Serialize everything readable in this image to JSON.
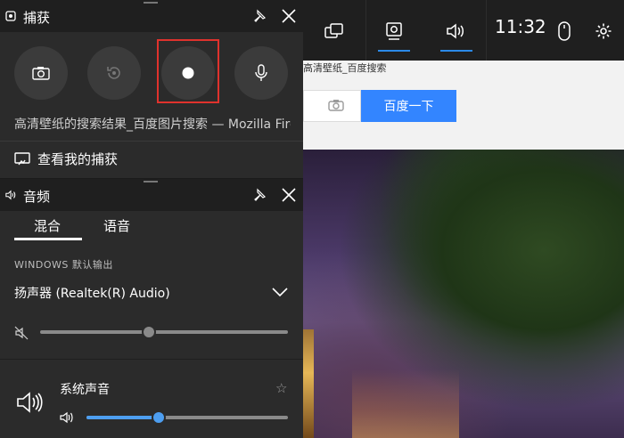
{
  "background": {
    "page_title": "高清壁纸_百度搜索",
    "search_button": "百度一下"
  },
  "game_bar": {
    "time": "11:32",
    "icons": [
      "widget-menu-icon",
      "capture-icon",
      "audio-icon",
      "mouse-icon",
      "settings-icon"
    ]
  },
  "capture_panel": {
    "title": "捕获",
    "window_title": "高清壁纸的搜索结果_百度图片搜索 — Mozilla Firefox",
    "see_captures": "查看我的捕获",
    "buttons": [
      "screenshot",
      "record-last",
      "start-recording",
      "microphone"
    ]
  },
  "audio_panel": {
    "title": "音频",
    "tabs": [
      {
        "label": "混合",
        "active": true
      },
      {
        "label": "语音",
        "active": false
      }
    ],
    "section_label": "WINDOWS 默认输出",
    "device": "扬声器 (Realtek(R) Audio)",
    "master_volume": 0.44,
    "app_name": "系统声音",
    "app_volume": 0.36,
    "accent_color": "#4d9ef0"
  }
}
